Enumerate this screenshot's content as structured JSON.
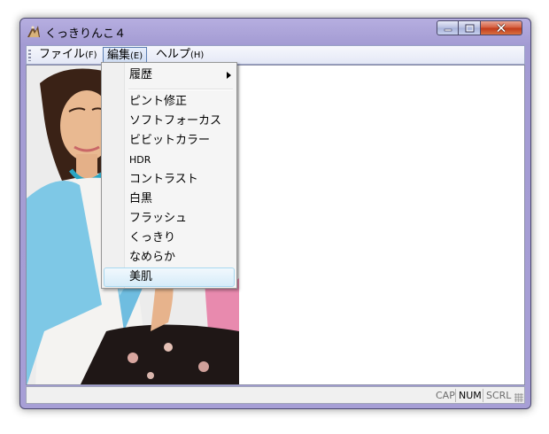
{
  "window": {
    "title": "くっきりんこ４",
    "controls": {
      "minimize": "minimize-icon",
      "maximize": "maximize-icon",
      "close": "close-icon"
    }
  },
  "menubar": {
    "file": {
      "label": "ファイル",
      "accel": "(F)"
    },
    "edit": {
      "label": "編集",
      "accel": "(E)"
    },
    "help": {
      "label": "ヘルプ",
      "accel": "(H)"
    }
  },
  "edit_menu": {
    "items": [
      {
        "label": "履歴",
        "has_submenu": true
      },
      {
        "label": "ピント修正"
      },
      {
        "label": "ソフトフォーカス"
      },
      {
        "label": "ビビットカラー"
      },
      {
        "label": "HDR"
      },
      {
        "label": "コントラスト"
      },
      {
        "label": "白黒"
      },
      {
        "label": "フラッシュ"
      },
      {
        "label": "くっきり"
      },
      {
        "label": "なめらか"
      },
      {
        "label": "美肌",
        "highlighted": true
      }
    ]
  },
  "statusbar": {
    "cap": "CAP",
    "num": "NUM",
    "scrl": "SCRL",
    "num_active": true
  },
  "colors": {
    "frame": "#a79fd6",
    "menu_highlight": "#d6ecf9",
    "close_button": "#c0391a"
  }
}
